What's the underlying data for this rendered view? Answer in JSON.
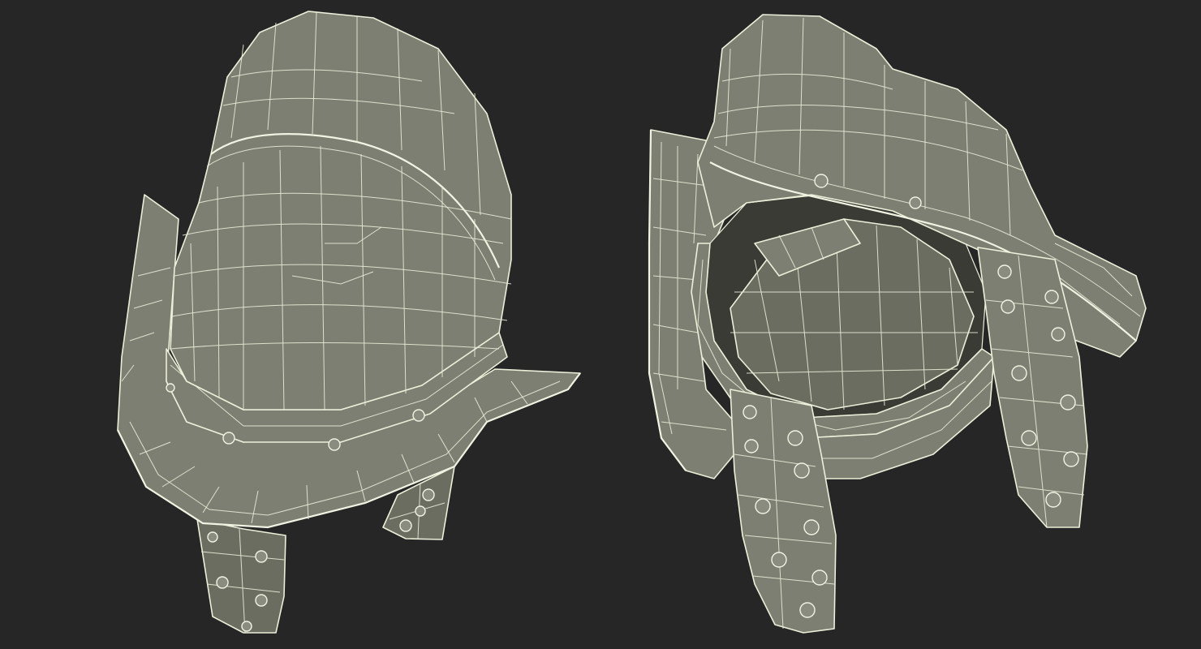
{
  "scene": {
    "background": "#262626",
    "surface_color": "#7d7f72",
    "wire_color": "#ecefd9",
    "views": [
      {
        "id": "front-three-quarter",
        "subject": "morion-helmet-wireframe"
      },
      {
        "id": "underside-three-quarter",
        "subject": "morion-helmet-wireframe"
      }
    ]
  }
}
